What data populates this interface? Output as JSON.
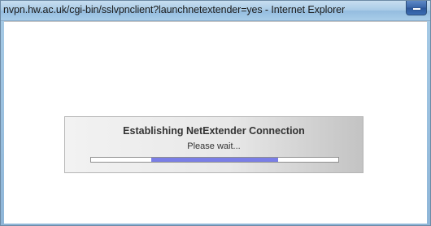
{
  "window": {
    "title": "nvpn.hw.ac.uk/cgi-bin/sslvpnclient?launchnetextender=yes - Internet Explorer"
  },
  "dialog": {
    "title": "Establishing NetExtender Connection",
    "subtitle": "Please wait...",
    "progress": {
      "start_fraction": 0.245,
      "end_fraction": 0.755,
      "fill_color": "#7a7ee6"
    }
  },
  "icons": {
    "minimize": "minimize-icon"
  }
}
